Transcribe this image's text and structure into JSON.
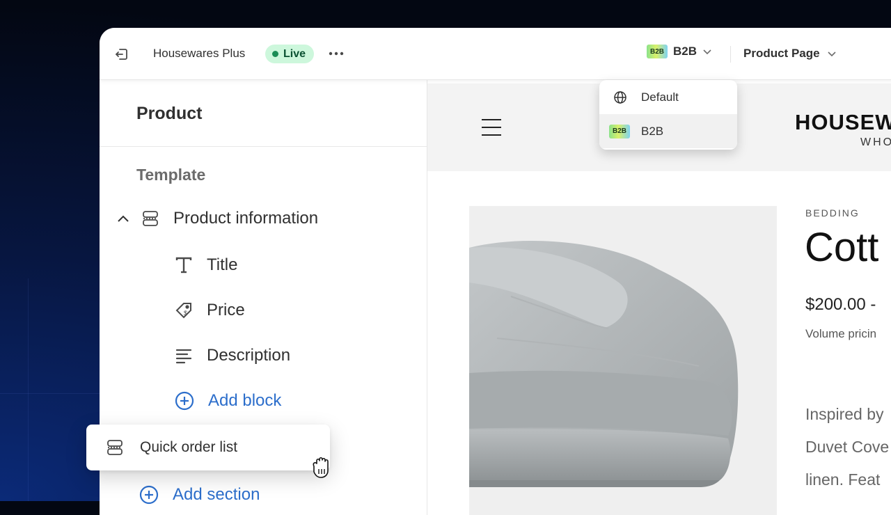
{
  "topbar": {
    "store_name": "Housewares Plus",
    "status_badge": "Live",
    "market_selector": {
      "chip": "B2B",
      "label": "B2B"
    },
    "page_selector": "Product Page"
  },
  "market_dropdown": {
    "items": [
      {
        "label": "Default",
        "icon": "globe-icon"
      },
      {
        "label": "B2B",
        "icon": "b2b-chip",
        "chip": "B2B",
        "selected": true
      }
    ]
  },
  "sidebar": {
    "title": "Product",
    "template_label": "Template",
    "section": {
      "label": "Product information",
      "blocks": [
        {
          "label": "Title",
          "icon": "text-icon"
        },
        {
          "label": "Price",
          "icon": "price-tag-icon"
        },
        {
          "label": "Description",
          "icon": "paragraph-icon"
        }
      ],
      "add_block": "Add block"
    },
    "add_section": "Add section"
  },
  "dragging_item": {
    "label": "Quick order list"
  },
  "preview": {
    "brand": "HOUSEW",
    "brand_sub": "WHO",
    "category": "BEDDING",
    "product_title": "Cott",
    "price": "$200.00  -",
    "volume_pricing": "Volume pricin",
    "description_lines": [
      "Inspired by",
      "Duvet Cove",
      "linen. Feat"
    ]
  },
  "colors": {
    "live_bg": "#cdf7dc",
    "live_dot": "#1a8d55",
    "link_blue": "#2c6ecb",
    "background_dark": "#030712"
  }
}
